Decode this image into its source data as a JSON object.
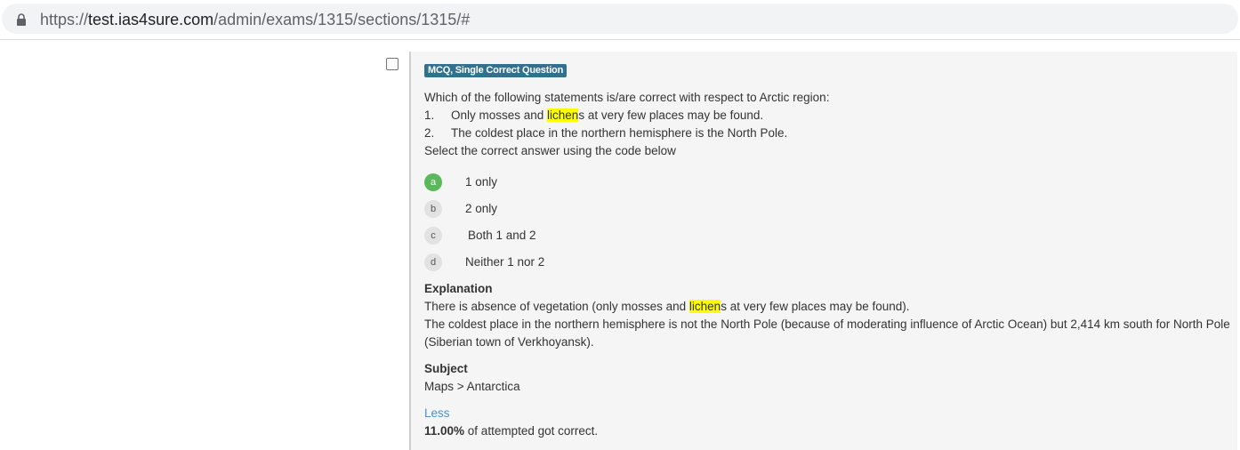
{
  "browser": {
    "url_scheme": "https://",
    "url_host": "test.ias4sure.com",
    "url_path": "/admin/exams/1315/sections/1315/#",
    "lock_icon": "lock-icon"
  },
  "question": {
    "type_badge": "MCQ, Single Correct Question",
    "intro": "Which of the following statements is/are correct with respect to Arctic region:",
    "statements": [
      {
        "num": "1.",
        "before": "Only mosses and ",
        "highlight": "lichen",
        "after": "s at very few places may be found."
      },
      {
        "num": "2.",
        "text": "The coldest place in the northern hemisphere is the North Pole."
      }
    ],
    "instruction": "Select the correct answer using the code below",
    "options": [
      {
        "letter": "a",
        "text": "1 only",
        "correct": true
      },
      {
        "letter": "b",
        "text": "2 only",
        "correct": false
      },
      {
        "letter": "c",
        "text": "Both 1 and 2",
        "correct": false
      },
      {
        "letter": "d",
        "text": "Neither 1 nor 2",
        "correct": false
      }
    ],
    "explanation": {
      "title": "Explanation",
      "line1_before": "There is absence of vegetation (only mosses and ",
      "line1_highlight": "lichen",
      "line1_after": "s at very few places may be found).",
      "line2": "The coldest place in the northern hemisphere is not the North Pole (because of moderating influence of Arctic Ocean) but 2,414 km south for North Pole (Siberian town of Verkhoyansk)."
    },
    "subject": {
      "title": "Subject",
      "value": "Maps > Antarctica"
    },
    "less_label": "Less",
    "stat": {
      "percent": "11.00%",
      "suffix": " of attempted got correct."
    }
  },
  "colors": {
    "badge": "#31708f",
    "correct_option": "#5cb85c",
    "highlight": "#ffff00",
    "link": "#4a90c7"
  }
}
